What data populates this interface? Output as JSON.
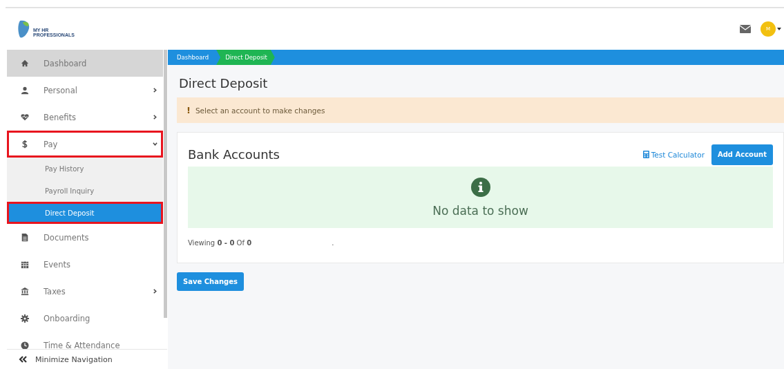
{
  "header": {
    "logo_text": [
      "MY HR",
      "PROFESSIONALS"
    ],
    "avatar": "M"
  },
  "sidebar": {
    "items": [
      {
        "label": "Dashboard",
        "kind": "link",
        "shaded": true,
        "highlighted": false
      },
      {
        "label": "Personal",
        "kind": "group",
        "shaded": false,
        "expanded": false,
        "highlighted": false
      },
      {
        "label": "Benefits",
        "kind": "group",
        "shaded": false,
        "expanded": false,
        "highlighted": false
      },
      {
        "label": "Pay",
        "kind": "group",
        "shaded": false,
        "expanded": true,
        "highlighted": true,
        "children": [
          {
            "label": "Pay History",
            "selected": false,
            "highlighted": false
          },
          {
            "label": "Payroll Inquiry",
            "selected": false,
            "highlighted": false
          },
          {
            "label": "Direct Deposit",
            "selected": true,
            "highlighted": true
          }
        ]
      },
      {
        "label": "Documents",
        "kind": "link",
        "shaded": false,
        "highlighted": false
      },
      {
        "label": "Events",
        "kind": "link",
        "shaded": false,
        "highlighted": false
      },
      {
        "label": "Taxes",
        "kind": "group",
        "shaded": false,
        "expanded": false,
        "highlighted": false
      },
      {
        "label": "Onboarding",
        "kind": "link",
        "shaded": false,
        "highlighted": false
      },
      {
        "label": "Time & Attendance",
        "kind": "link",
        "shaded": false,
        "highlighted": false
      }
    ],
    "minimize": "Minimize Navigation"
  },
  "breadcrumbs": [
    {
      "label": "Dashboard",
      "selected": false
    },
    {
      "label": "Direct Deposit",
      "selected": true
    }
  ],
  "page_title": "Direct Deposit",
  "alert": {
    "mark": "!",
    "text": "Select an account to make changes"
  },
  "card": {
    "title": "Bank Accounts",
    "link": "Test Calculator",
    "button": "Add Account",
    "empty_text": "No data to show",
    "viewing": "Viewing **0 - 0** Of **0**",
    "dot": "."
  },
  "save_button": "Save Changes"
}
